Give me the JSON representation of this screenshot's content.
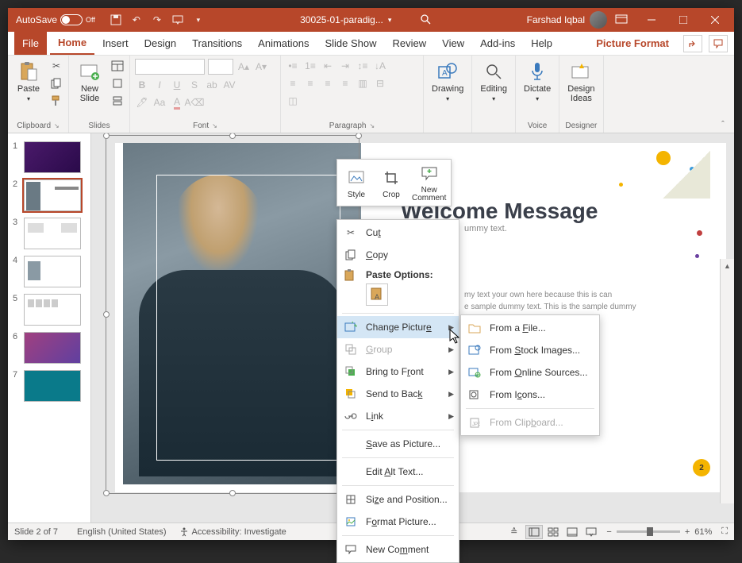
{
  "titlebar": {
    "autosave_label": "AutoSave",
    "autosave_state": "Off",
    "filename": "30025-01-paradig...",
    "user": "Farshad Iqbal"
  },
  "tabs": {
    "file": "File",
    "items": [
      "Home",
      "Insert",
      "Design",
      "Transitions",
      "Animations",
      "Slide Show",
      "Review",
      "View",
      "Add-ins",
      "Help"
    ],
    "context": "Picture Format",
    "active": "Home"
  },
  "ribbon": {
    "clipboard": {
      "paste": "Paste",
      "label": "Clipboard"
    },
    "slides": {
      "newslide": "New\nSlide",
      "label": "Slides"
    },
    "font": {
      "label": "Font"
    },
    "paragraph": {
      "label": "Paragraph"
    },
    "drawing": {
      "btn": "Drawing",
      "label": ""
    },
    "editing": {
      "btn": "Editing",
      "label": ""
    },
    "voice": {
      "dictate": "Dictate",
      "label": "Voice"
    },
    "designer": {
      "ideas": "Design\nIdeas",
      "label": "Designer"
    }
  },
  "thumbs": {
    "count": 7,
    "active": 2
  },
  "slide": {
    "title": "Welcome Message",
    "subtitle": "ummy text.",
    "body": "my text  your own here because this is can\ne sample dummy text. This is the sample dummy\nample",
    "page_badge": "2"
  },
  "mini_toolbar": {
    "style": "Style",
    "crop": "Crop",
    "new_comment": "New\nComment"
  },
  "context_menu": {
    "cut": "Cut",
    "copy": "Copy",
    "paste_header": "Paste Options:",
    "change_picture": "Change Picture",
    "group": "Group",
    "bring_front": "Bring to Front",
    "send_back": "Send to Back",
    "link": "Link",
    "save_as_picture": "Save as Picture...",
    "edit_alt": "Edit Alt Text...",
    "size_pos": "Size and Position...",
    "format_picture": "Format Picture...",
    "new_comment": "New Comment"
  },
  "submenu": {
    "from_file": "From a File...",
    "from_stock": "From Stock Images...",
    "from_online": "From Online Sources...",
    "from_icons": "From Icons...",
    "from_clipboard": "From Clipboard..."
  },
  "statusbar": {
    "slide_info": "Slide 2 of 7",
    "language": "English (United States)",
    "accessibility": "Accessibility: Investigate",
    "zoom": "61%"
  }
}
